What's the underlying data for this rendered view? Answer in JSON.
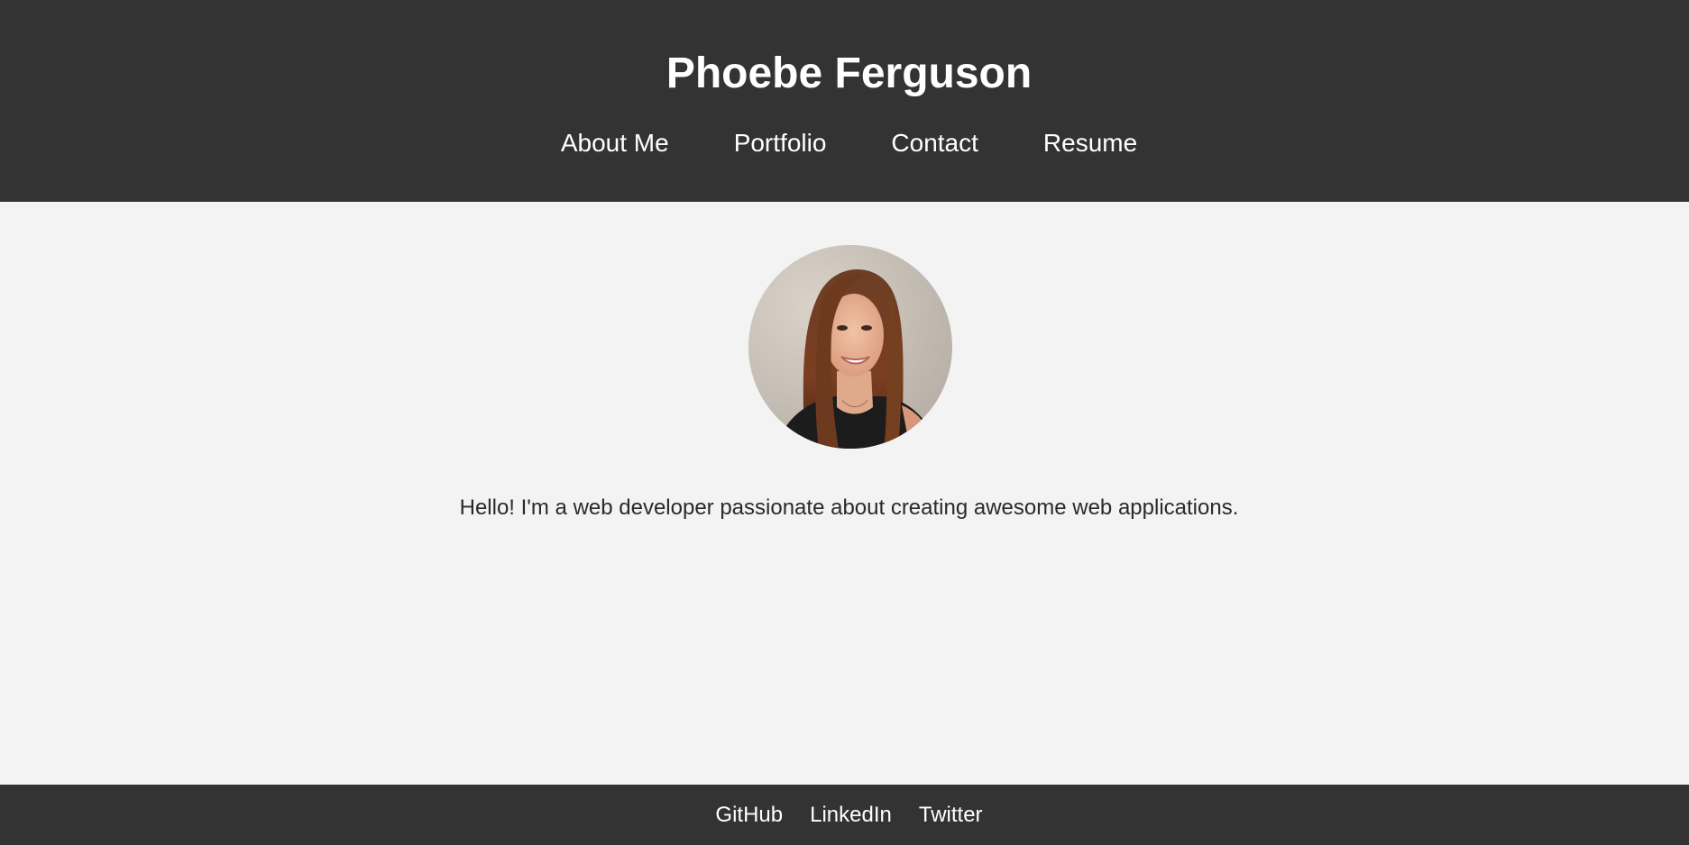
{
  "header": {
    "title": "Phoebe Ferguson",
    "nav": [
      {
        "label": "About Me"
      },
      {
        "label": "Portfolio"
      },
      {
        "label": "Contact"
      },
      {
        "label": "Resume"
      }
    ]
  },
  "main": {
    "intro": "Hello! I'm a web developer passionate about creating awesome web applications."
  },
  "footer": {
    "links": [
      {
        "label": "GitHub"
      },
      {
        "label": "LinkedIn"
      },
      {
        "label": "Twitter"
      }
    ]
  },
  "colors": {
    "header_bg": "#333333",
    "page_bg": "#f3f3f3",
    "text": "#2a2a2a",
    "nav_text": "#ffffff"
  }
}
